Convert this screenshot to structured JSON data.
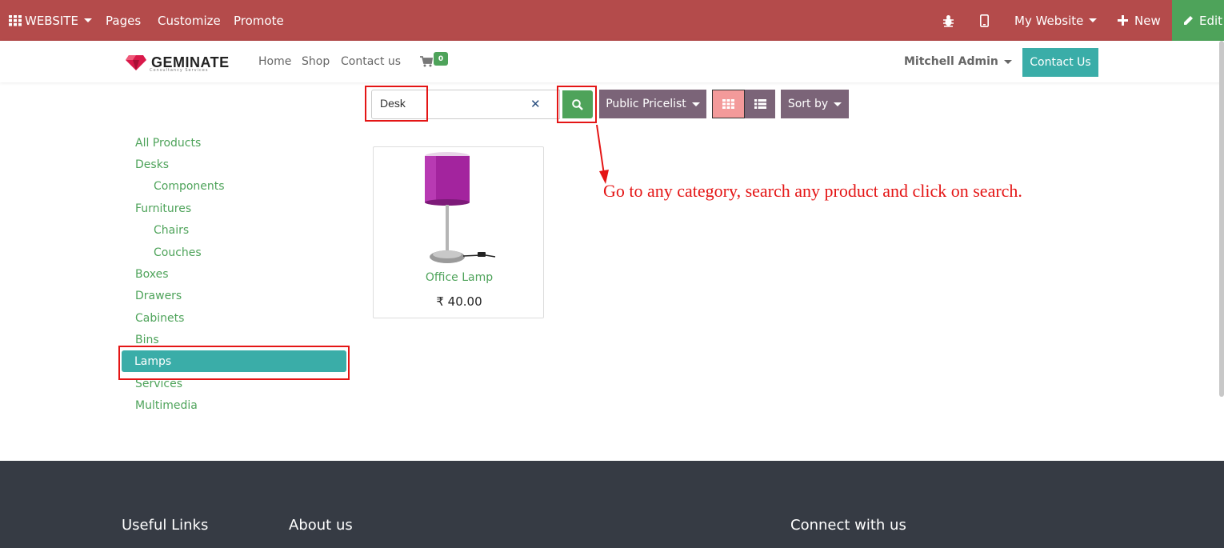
{
  "admin_bar": {
    "apps_label": "WEBSITE",
    "pages_label": "Pages",
    "customize_label": "Customize",
    "promote_label": "Promote",
    "debug_icon": "bug-icon",
    "mobile_icon": "mobile-icon",
    "website_label": "My Website",
    "new_label": "New",
    "edit_label": "Edit",
    "bar_color": "#b44b4b",
    "edit_color": "#4ea35a"
  },
  "header": {
    "logo_text": "GEMINATE",
    "logo_sub": "Consultancy Services",
    "nav": [
      "Home",
      "Shop",
      "Contact us"
    ],
    "cart_count": "0",
    "user_label": "Mitchell Admin",
    "contact_button": "Contact Us",
    "accent_color": "#3aada8"
  },
  "search": {
    "value": "Desk",
    "pricelist_label": "Public Pricelist",
    "sort_label": "Sort by"
  },
  "categories": [
    {
      "label": "All Products",
      "level": 0
    },
    {
      "label": "Desks",
      "level": 0
    },
    {
      "label": "Components",
      "level": 1
    },
    {
      "label": "Furnitures",
      "level": 0
    },
    {
      "label": "Chairs",
      "level": 1
    },
    {
      "label": "Couches",
      "level": 1
    },
    {
      "label": "Boxes",
      "level": 0
    },
    {
      "label": "Drawers",
      "level": 0
    },
    {
      "label": "Cabinets",
      "level": 0
    },
    {
      "label": "Bins",
      "level": 0
    },
    {
      "label": "Lamps",
      "level": 0,
      "active": true
    },
    {
      "label": "Services",
      "level": 0
    },
    {
      "label": "Multimedia",
      "level": 0
    }
  ],
  "products": [
    {
      "name": "Office Lamp",
      "price": "₹ 40.00"
    }
  ],
  "annotation": "Go to any category, search any product and click on search.",
  "footer": {
    "useful_links": "Useful Links",
    "about_us": "About us",
    "connect": "Connect with us"
  }
}
